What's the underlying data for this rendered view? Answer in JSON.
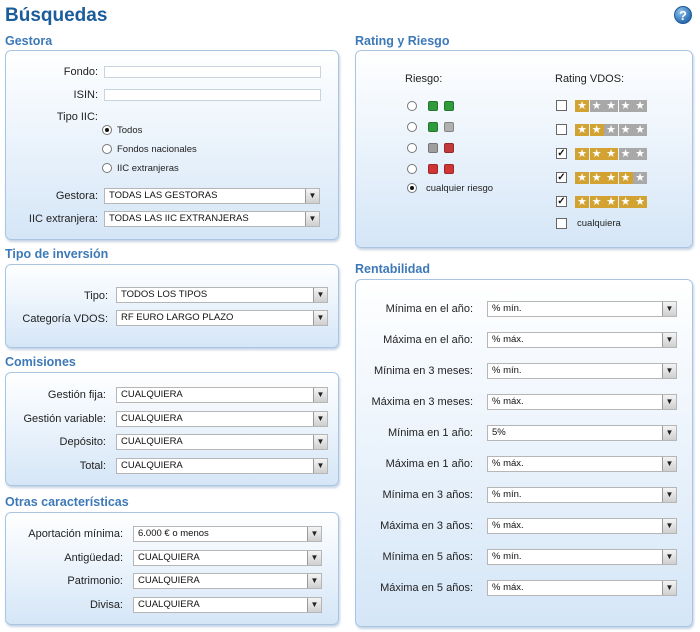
{
  "page": {
    "title": "Búsquedas",
    "help": "?"
  },
  "gestora": {
    "title": "Gestora",
    "fondo_label": "Fondo:",
    "isin_label": "ISIN:",
    "tipo_label": "Tipo IIC:",
    "tipo_options": [
      "Todos",
      "Fondos nacionales",
      "IIC extranjeras"
    ],
    "gestora_label": "Gestora:",
    "gestora_value": "TODAS LAS GESTORAS",
    "iic_label": "IIC extranjera:",
    "iic_value": "TODAS LAS IIC EXTRANJERAS"
  },
  "rating": {
    "title": "Rating y Riesgo",
    "riesgo_label": "Riesgo:",
    "rating_label": "Rating VDOS:",
    "cualquier_riesgo": "cualquier riesgo",
    "cualquiera": "cualquiera",
    "risk_rows": [
      {
        "colors": [
          "#2f9b3c",
          "#2f9b3c"
        ]
      },
      {
        "colors": [
          "#2f9b3c",
          "#b0b0b0"
        ]
      },
      {
        "colors": [
          "#9e9e9e",
          "#c33a3a"
        ]
      },
      {
        "colors": [
          "#d03434",
          "#d03434"
        ]
      }
    ],
    "rating_rows": [
      {
        "stars": 1,
        "checked": false
      },
      {
        "stars": 2,
        "checked": false
      },
      {
        "stars": 3,
        "checked": true
      },
      {
        "stars": 4,
        "checked": true
      },
      {
        "stars": 5,
        "checked": true
      }
    ],
    "colors": {
      "gold": "#d2a332",
      "gray": "#a8a8a8"
    }
  },
  "tipo_inversion": {
    "title": "Tipo de inversión",
    "tipo_label": "Tipo:",
    "tipo_value": "TODOS LOS TIPOS",
    "cat_label": "Categoría VDOS:",
    "cat_value": "RF EURO LARGO PLAZO"
  },
  "comisiones": {
    "title": "Comisiones",
    "rows": [
      {
        "label": "Gestión fija:",
        "value": "CUALQUIERA"
      },
      {
        "label": "Gestión variable:",
        "value": "CUALQUIERA"
      },
      {
        "label": "Depósito:",
        "value": "CUALQUIERA"
      },
      {
        "label": "Total:",
        "value": "CUALQUIERA"
      }
    ]
  },
  "otras": {
    "title": "Otras características",
    "rows": [
      {
        "label": "Aportación mínima:",
        "value": "6.000 € o menos"
      },
      {
        "label": "Antigüedad:",
        "value": "CUALQUIERA"
      },
      {
        "label": "Patrimonio:",
        "value": "CUALQUIERA"
      },
      {
        "label": "Divisa:",
        "value": "CUALQUIERA"
      }
    ]
  },
  "rentabilidad": {
    "title": "Rentabilidad",
    "rows": [
      {
        "label": "Mínima en el año:",
        "value": "% mín."
      },
      {
        "label": "Máxima en el año:",
        "value": "% máx."
      },
      {
        "label": "Mínima en 3 meses:",
        "value": "% mín."
      },
      {
        "label": "Máxima en 3 meses:",
        "value": "% máx."
      },
      {
        "label": "Mínima en 1 año:",
        "value": "5%"
      },
      {
        "label": "Máxima en 1 año:",
        "value": "% máx."
      },
      {
        "label": "Mínima en 3 años:",
        "value": "% mín."
      },
      {
        "label": "Máxima en 3 años:",
        "value": "% máx."
      },
      {
        "label": "Mínima en 5 años:",
        "value": "% mín."
      },
      {
        "label": "Máxima en 5 años:",
        "value": "% máx."
      }
    ]
  }
}
